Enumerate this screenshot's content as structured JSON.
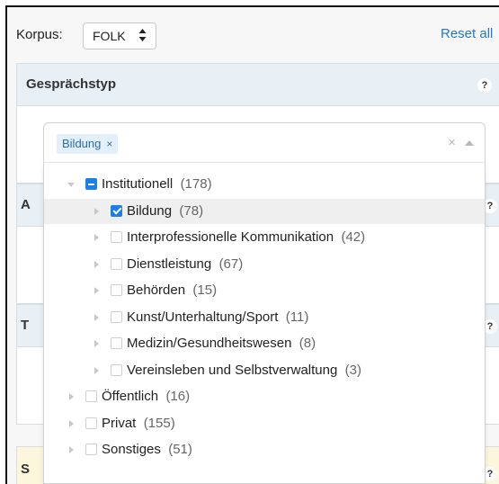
{
  "korpus": {
    "label": "Korpus:",
    "value": "FOLK",
    "caret": "♦"
  },
  "reset_label": "Reset all",
  "panels": {
    "gespraechstyp": {
      "title": "Gesprächstyp",
      "help": "?"
    },
    "second": {
      "title_fragment": "A",
      "help": "?"
    },
    "third": {
      "title_fragment": "T",
      "help": "?"
    },
    "fourth": {
      "title_fragment": "S",
      "help": "?"
    }
  },
  "select": {
    "selected_tag": "Bildung",
    "tag_remove": "×",
    "clear": "×"
  },
  "tree": [
    {
      "label": "Institutionell",
      "count": "(178)",
      "level": 0,
      "expanded": true,
      "state": "partial"
    },
    {
      "label": "Bildung",
      "count": "(78)",
      "level": 1,
      "expanded": false,
      "state": "checked",
      "highlighted": true
    },
    {
      "label": "Interprofessionelle Kommunikation",
      "count": "(42)",
      "level": 1,
      "expanded": false,
      "state": "unchecked"
    },
    {
      "label": "Dienstleistung",
      "count": "(67)",
      "level": 1,
      "expanded": false,
      "state": "unchecked"
    },
    {
      "label": "Behörden",
      "count": "(15)",
      "level": 1,
      "expanded": false,
      "state": "unchecked"
    },
    {
      "label": "Kunst/Unterhaltung/Sport",
      "count": "(11)",
      "level": 1,
      "expanded": false,
      "state": "unchecked"
    },
    {
      "label": "Medizin/Gesundheitswesen",
      "count": "(8)",
      "level": 1,
      "expanded": false,
      "state": "unchecked"
    },
    {
      "label": "Vereinsleben und Selbstverwaltung",
      "count": "(3)",
      "level": 1,
      "expanded": false,
      "state": "unchecked"
    },
    {
      "label": "Öffentlich",
      "count": "(16)",
      "level": 0,
      "expanded": false,
      "state": "unchecked"
    },
    {
      "label": "Privat",
      "count": "(155)",
      "level": 0,
      "expanded": false,
      "state": "unchecked"
    },
    {
      "label": "Sonstiges",
      "count": "(51)",
      "level": 0,
      "expanded": false,
      "state": "unchecked"
    }
  ],
  "colors": {
    "accent": "#1a7fe6",
    "link": "#2679c7",
    "panel_header": "#e8eff5",
    "tag_bg": "#e3f0fb"
  }
}
